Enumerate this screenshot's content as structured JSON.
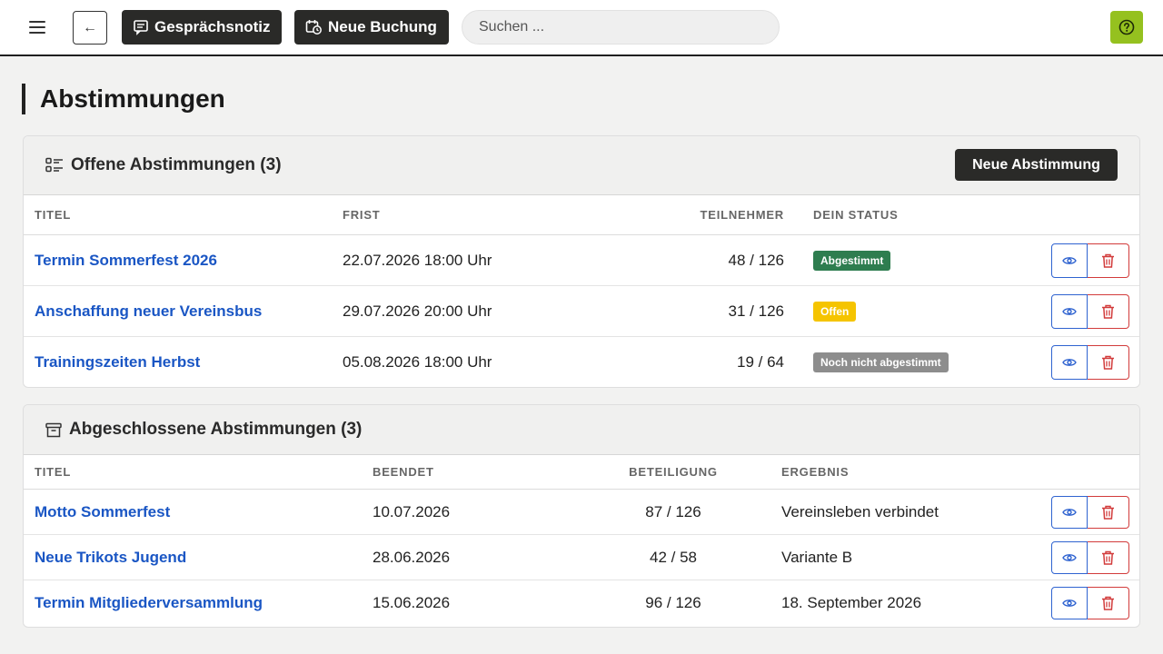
{
  "header": {
    "note_button_label": "Gesprächsnotiz",
    "booking_button_label": "Neue Buchung",
    "search_placeholder": "Suchen ...",
    "back_glyph": "←",
    "accent_color": "#95c11f"
  },
  "page": {
    "title": "Abstimmungen"
  },
  "open_votes": {
    "title": "Offene Abstimmungen (3)",
    "new_button_label": "Neue Abstimmung",
    "columns": [
      "TITEL",
      "FRIST",
      "TEILNEHMER",
      "DEIN STATUS"
    ],
    "rows": [
      {
        "title": "Termin Sommerfest 2026",
        "deadline": "22.07.2026 18:00 Uhr",
        "participants": "48 / 126",
        "status": "Abgestimmt",
        "status_color": "#2e7d4f"
      },
      {
        "title": "Anschaffung neuer Vereinsbus",
        "deadline": "29.07.2026 20:00 Uhr",
        "participants": "31 / 126",
        "status": "Offen",
        "status_color": "#f5c400"
      },
      {
        "title": "Trainingszeiten Herbst",
        "deadline": "05.08.2026 18:00 Uhr",
        "participants": "19 / 64",
        "status": "Noch nicht abgestimmt",
        "status_color": "#8d8d8d"
      }
    ]
  },
  "closed_votes": {
    "title": "Abgeschlossene Abstimmungen (3)",
    "columns": [
      "TITEL",
      "BEENDET",
      "BETEILIGUNG",
      "ERGEBNIS"
    ],
    "rows": [
      {
        "title": "Motto Sommerfest",
        "ended": "10.07.2026",
        "participation": "87 / 126",
        "result": "Vereinsleben verbindet"
      },
      {
        "title": "Neue Trikots Jugend",
        "ended": "28.06.2026",
        "participation": "42 / 58",
        "result": "Variante B"
      },
      {
        "title": "Termin Mitgliederversammlung",
        "ended": "15.06.2026",
        "participation": "96 / 126",
        "result": "18. September 2026"
      }
    ]
  },
  "icons": {
    "menu": "hamburger-icon",
    "back": "arrow-left-icon",
    "note": "note-icon",
    "booking": "calendar-booking-icon",
    "help": "question-icon",
    "open_section": "list-checks-icon",
    "closed_section": "archive-icon",
    "view": "eye-icon",
    "delete": "trash-icon"
  }
}
